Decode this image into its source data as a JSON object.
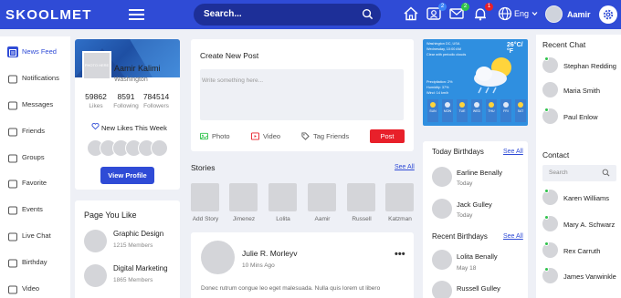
{
  "header": {
    "logo": "SKOOLMET",
    "search_placeholder": "Search...",
    "badges": {
      "friends": "2",
      "messages": "2",
      "notifications": "1"
    },
    "language": "Eng",
    "user_name": "Aamir"
  },
  "leftnav": {
    "items": [
      {
        "label": "News Feed",
        "icon": "newsfeed-icon",
        "active": true
      },
      {
        "label": "Notifications",
        "icon": "bell-icon",
        "active": false
      },
      {
        "label": "Messages",
        "icon": "message-icon",
        "active": false
      },
      {
        "label": "Friends",
        "icon": "friends-icon",
        "active": false
      },
      {
        "label": "Groups",
        "icon": "groups-icon",
        "active": false
      },
      {
        "label": "Favorite",
        "icon": "star-icon",
        "active": false
      },
      {
        "label": "Events",
        "icon": "calendar-icon",
        "active": false
      },
      {
        "label": "Live Chat",
        "icon": "chat-icon",
        "active": false
      },
      {
        "label": "Birthday",
        "icon": "gift-icon",
        "active": false
      },
      {
        "label": "Video",
        "icon": "video-icon",
        "active": false
      }
    ]
  },
  "profile": {
    "name": "Aamir Kalimi",
    "location": "Washington",
    "photo_placeholder": "PHOTO HERE",
    "stats": [
      {
        "value": "59862",
        "label": "Likes"
      },
      {
        "value": "8591",
        "label": "Following"
      },
      {
        "value": "784514",
        "label": "Followers"
      }
    ],
    "new_likes_label": "New Likes This Week",
    "view_profile_label": "View Profile"
  },
  "pages": {
    "title": "Page You Like",
    "items": [
      {
        "name": "Graphic Design",
        "members": "1215 Members"
      },
      {
        "name": "Digital Marketing",
        "members": "1865 Members"
      }
    ]
  },
  "create_post": {
    "title": "Create New Post",
    "placeholder": "Write something here...",
    "actions": {
      "photo": "Photo",
      "video": "Video",
      "tag": "Tag Friends"
    },
    "post_label": "Post"
  },
  "stories": {
    "title": "Stories",
    "see_all": "See All",
    "items": [
      "Add Story",
      "Jimenez",
      "Lolita",
      "Aamir",
      "Russell",
      "Katzman"
    ]
  },
  "feed_post": {
    "author": "Julie R. Morleyv",
    "time": "10 Mins Ago",
    "text": "Donec rutrum congue leo eget malesuada. Nulla quis lorem ut libero"
  },
  "weather": {
    "location": "Washington DC, USA",
    "date": "Wednesday, 10:00 AM",
    "condition": "Clear with periodic clouds",
    "temp": "26°C/°F",
    "precipitation": "Precipitation: 2%",
    "humidity": "Humidity: 37%",
    "wind": "Wind: 14 km/h",
    "days": [
      "SUN",
      "MON",
      "TUE",
      "WED",
      "THU",
      "FRI",
      "SAT"
    ]
  },
  "today_birthdays": {
    "title": "Today Birthdays",
    "see_all": "See All",
    "items": [
      {
        "name": "Earline Benally",
        "day": "Today"
      },
      {
        "name": "Jack Gulley",
        "day": "Today"
      }
    ]
  },
  "recent_birthdays": {
    "title": "Recent Birthdays",
    "see_all": "See All",
    "items": [
      {
        "name": "Lolita Benally",
        "day": "May 18"
      },
      {
        "name": "Russell Gulley",
        "day": ""
      }
    ]
  },
  "recent_chat": {
    "title": "Recent Chat",
    "items": [
      "Stephan Redding",
      "Maria Smith",
      "Paul Enlow"
    ]
  },
  "contact": {
    "title": "Contact",
    "search_placeholder": "Search",
    "items": [
      "Karen Williams",
      "Mary A. Schwarz",
      "Rex Carruth",
      "James Vanwinkle"
    ]
  },
  "colors": {
    "primary": "#2f4bd6",
    "post_button": "#e8202a",
    "online": "#2fc34b"
  }
}
